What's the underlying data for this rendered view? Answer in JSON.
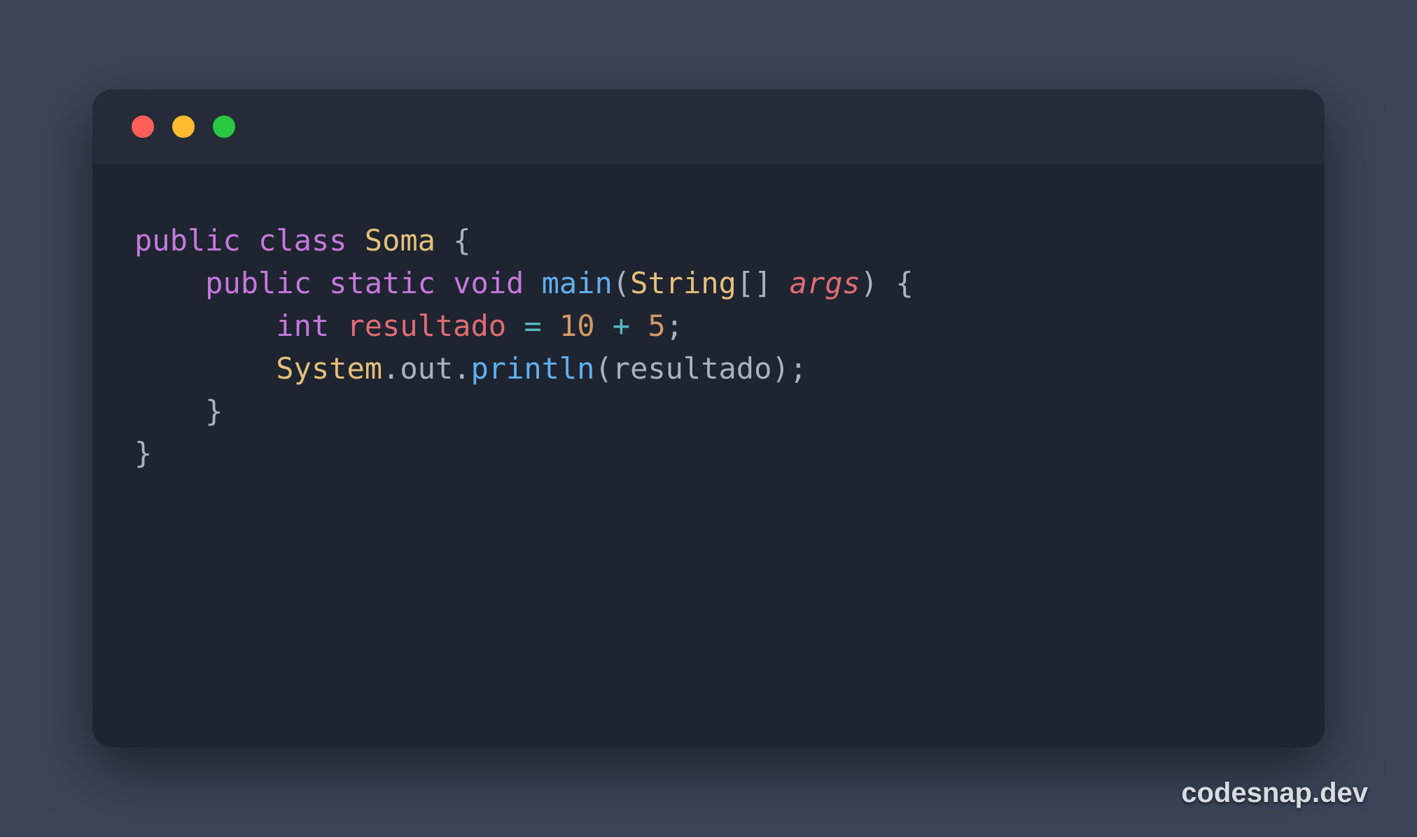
{
  "watermark": "codesnap.dev",
  "window": {
    "controls": [
      "close",
      "minimize",
      "zoom"
    ]
  },
  "code": {
    "language": "java",
    "lines": [
      [
        {
          "t": "public",
          "c": "keyword"
        },
        {
          "t": " ",
          "c": "punct"
        },
        {
          "t": "class",
          "c": "keyword"
        },
        {
          "t": " ",
          "c": "punct"
        },
        {
          "t": "Soma",
          "c": "class"
        },
        {
          "t": " ",
          "c": "punct"
        },
        {
          "t": "{",
          "c": "punct"
        }
      ],
      [
        {
          "t": "    ",
          "c": "punct"
        },
        {
          "t": "public",
          "c": "keyword"
        },
        {
          "t": " ",
          "c": "punct"
        },
        {
          "t": "static",
          "c": "keyword"
        },
        {
          "t": " ",
          "c": "punct"
        },
        {
          "t": "void",
          "c": "keyword"
        },
        {
          "t": " ",
          "c": "punct"
        },
        {
          "t": "main",
          "c": "method"
        },
        {
          "t": "(",
          "c": "punct"
        },
        {
          "t": "String",
          "c": "type"
        },
        {
          "t": "[] ",
          "c": "punct"
        },
        {
          "t": "args",
          "c": "param"
        },
        {
          "t": ")",
          "c": "punct"
        },
        {
          "t": " ",
          "c": "punct"
        },
        {
          "t": "{",
          "c": "punct"
        }
      ],
      [
        {
          "t": "        ",
          "c": "punct"
        },
        {
          "t": "int",
          "c": "keyword"
        },
        {
          "t": " ",
          "c": "punct"
        },
        {
          "t": "resultado",
          "c": "var"
        },
        {
          "t": " ",
          "c": "punct"
        },
        {
          "t": "=",
          "c": "op"
        },
        {
          "t": " ",
          "c": "punct"
        },
        {
          "t": "10",
          "c": "number"
        },
        {
          "t": " ",
          "c": "punct"
        },
        {
          "t": "+",
          "c": "op"
        },
        {
          "t": " ",
          "c": "punct"
        },
        {
          "t": "5",
          "c": "number"
        },
        {
          "t": ";",
          "c": "punct"
        }
      ],
      [
        {
          "t": "        ",
          "c": "punct"
        },
        {
          "t": "System",
          "c": "type"
        },
        {
          "t": ".",
          "c": "punct"
        },
        {
          "t": "out",
          "c": "ident"
        },
        {
          "t": ".",
          "c": "punct"
        },
        {
          "t": "println",
          "c": "method"
        },
        {
          "t": "(",
          "c": "punct"
        },
        {
          "t": "resultado",
          "c": "ident"
        },
        {
          "t": ")",
          "c": "punct"
        },
        {
          "t": ";",
          "c": "punct"
        }
      ],
      [
        {
          "t": "    ",
          "c": "punct"
        },
        {
          "t": "}",
          "c": "punct"
        }
      ],
      [
        {
          "t": "}",
          "c": "punct"
        }
      ]
    ]
  }
}
